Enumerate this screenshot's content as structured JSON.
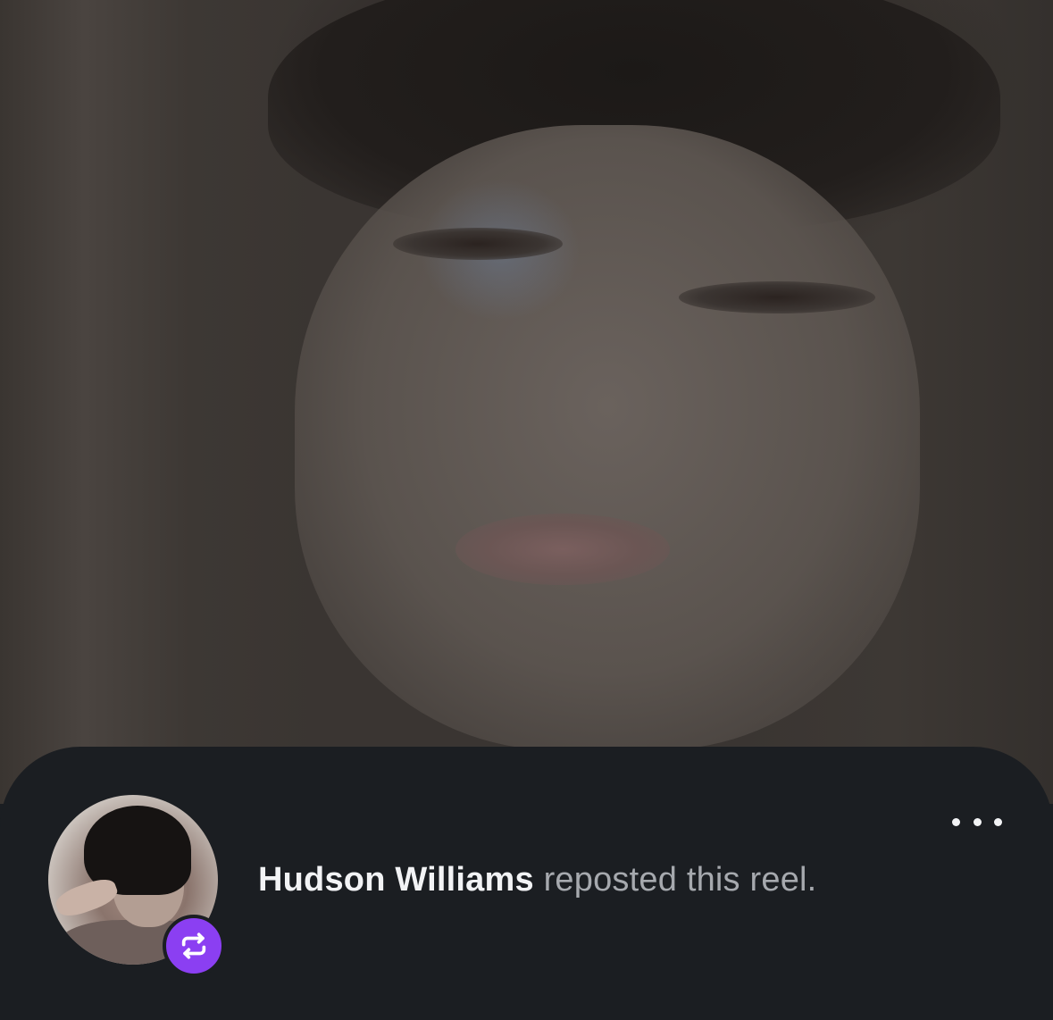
{
  "reel": {
    "media": "reel-video-frame"
  },
  "repost": {
    "username": "Hudson Williams",
    "action_text": "reposted this reel.",
    "avatar": "user-avatar",
    "badge_icon": "repost-icon",
    "more_icon": "more-horizontal-icon"
  },
  "colors": {
    "sheet_background": "#1b1e22",
    "username": "#f2f3f5",
    "action_text": "#a6a9ae",
    "repost_badge": "#8b3ff2"
  }
}
